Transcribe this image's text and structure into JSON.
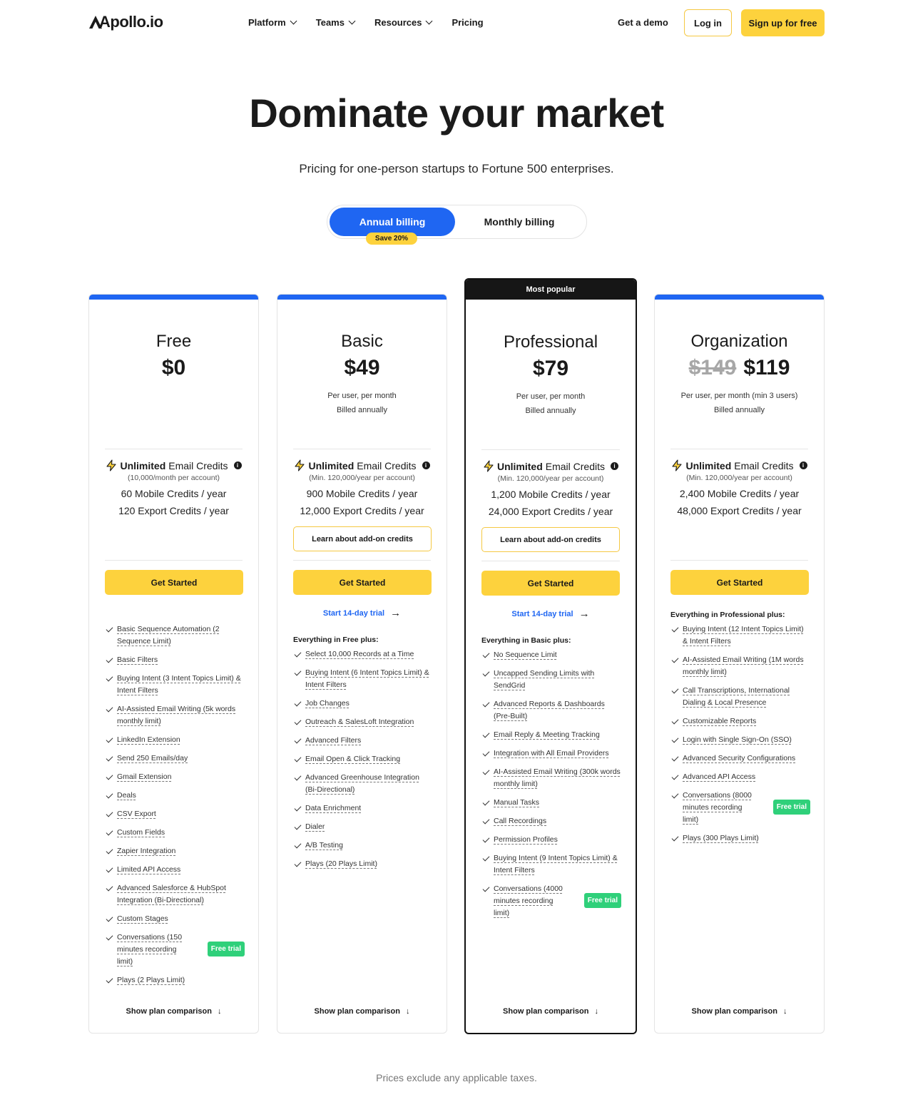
{
  "header": {
    "logo": "Apollo.io",
    "nav": [
      {
        "label": "Platform",
        "dropdown": true
      },
      {
        "label": "Teams",
        "dropdown": true
      },
      {
        "label": "Resources",
        "dropdown": true
      },
      {
        "label": "Pricing",
        "dropdown": false
      }
    ],
    "demo_label": "Get a demo",
    "login_label": "Log in",
    "signup_label": "Sign up for free"
  },
  "hero": {
    "title": "Dominate your market",
    "subtitle": "Pricing for one-person startups to Fortune 500 enterprises."
  },
  "billing": {
    "annual_label": "Annual billing",
    "monthly_label": "Monthly billing",
    "save_badge": "Save 20%",
    "selected": "annual"
  },
  "colors": {
    "accent_blue": "#1f66f2",
    "accent_yellow": "#fdd23d",
    "trial_green": "#2fd07a"
  },
  "plans": [
    {
      "name": "Free",
      "price": "$0",
      "old_price": "",
      "note1": "",
      "note2": "",
      "unlimited_bold": "Unlimited",
      "unlimited_rest": "Email Credits",
      "unlimited_sub": "(10,000/month per account)",
      "mobile": "60 Mobile Credits / year",
      "export": "120 Export Credits / year",
      "addon": "",
      "cta": "Get Started",
      "trial": "",
      "features_head": "",
      "features": [
        {
          "t": "Basic Sequence Automation (2 Sequence Limit)"
        },
        {
          "t": "Basic Filters"
        },
        {
          "t": "Buying Intent (3 Intent Topics Limit) & Intent Filters"
        },
        {
          "t": "AI-Assisted Email Writing (5k words monthly limit)"
        },
        {
          "t": "LinkedIn Extension"
        },
        {
          "t": "Send 250 Emails/day"
        },
        {
          "t": "Gmail Extension"
        },
        {
          "t": "Deals"
        },
        {
          "t": "CSV Export"
        },
        {
          "t": "Custom Fields"
        },
        {
          "t": "Zapier Integration"
        },
        {
          "t": "Limited API Access"
        },
        {
          "t": "Advanced Salesforce & HubSpot Integration (Bi-Directional)"
        },
        {
          "t": "Custom Stages"
        },
        {
          "t": "Conversations (150 minutes recording limit)",
          "badge": "Free trial"
        },
        {
          "t": "Plays (2 Plays Limit)"
        }
      ],
      "compare": "Show plan comparison"
    },
    {
      "name": "Basic",
      "price": "$49",
      "old_price": "",
      "note1": "Per user, per month",
      "note2": "Billed annually",
      "unlimited_bold": "Unlimited",
      "unlimited_rest": "Email Credits",
      "unlimited_sub": "(Min. 120,000/year per account)",
      "mobile": "900 Mobile Credits / year",
      "export": "12,000 Export Credits / year",
      "addon": "Learn about add-on credits",
      "cta": "Get Started",
      "trial": "Start 14-day trial",
      "features_head": "Everything in Free plus:",
      "features": [
        {
          "t": "Select 10,000 Records at a Time"
        },
        {
          "t": "Buying Intent (6 Intent Topics Limit) & Intent Filters"
        },
        {
          "t": "Job Changes"
        },
        {
          "t": "Outreach & SalesLoft Integration"
        },
        {
          "t": "Advanced Filters"
        },
        {
          "t": "Email Open & Click Tracking"
        },
        {
          "t": "Advanced Greenhouse Integration (Bi-Directional)"
        },
        {
          "t": "Data Enrichment"
        },
        {
          "t": "Dialer"
        },
        {
          "t": "A/B Testing"
        },
        {
          "t": "Plays (20 Plays Limit)"
        }
      ],
      "compare": "Show plan comparison"
    },
    {
      "name": "Professional",
      "price": "$79",
      "old_price": "",
      "popular_label": "Most popular",
      "note1": "Per user, per month",
      "note2": "Billed annually",
      "unlimited_bold": "Unlimited",
      "unlimited_rest": "Email Credits",
      "unlimited_sub": "(Min. 120,000/year per account)",
      "mobile": "1,200 Mobile Credits / year",
      "export": "24,000 Export Credits / year",
      "addon": "Learn about add-on credits",
      "cta": "Get Started",
      "trial": "Start 14-day trial",
      "features_head": "Everything in Basic plus:",
      "features": [
        {
          "t": "No Sequence Limit"
        },
        {
          "t": "Uncapped Sending Limits with SendGrid"
        },
        {
          "t": "Advanced Reports & Dashboards (Pre-Built)"
        },
        {
          "t": "Email Reply & Meeting Tracking"
        },
        {
          "t": "Integration with All Email Providers"
        },
        {
          "t": "AI-Assisted Email Writing (300k words monthly limit)"
        },
        {
          "t": "Manual Tasks"
        },
        {
          "t": "Call Recordings"
        },
        {
          "t": "Permission Profiles"
        },
        {
          "t": "Buying Intent (9 Intent Topics Limit) & Intent Filters"
        },
        {
          "t": "Conversations (4000 minutes recording limit)",
          "badge": "Free trial"
        }
      ],
      "compare": "Show plan comparison"
    },
    {
      "name": "Organization",
      "price": "$119",
      "old_price": "$149",
      "note1": "Per user, per month (min 3 users)",
      "note2": "Billed annually",
      "unlimited_bold": "Unlimited",
      "unlimited_rest": "Email Credits",
      "unlimited_sub": "(Min. 120,000/year per account)",
      "mobile": "2,400 Mobile Credits / year",
      "export": "48,000 Export Credits / year",
      "addon": "",
      "cta": "Get Started",
      "trial": "",
      "features_head": "Everything in Professional plus:",
      "features": [
        {
          "t": "Buying Intent (12 Intent Topics Limit) & Intent Filters"
        },
        {
          "t": "AI-Assisted Email Writing (1M words monthly limit)"
        },
        {
          "t": "Call Transcriptions, International Dialing & Local Presence"
        },
        {
          "t": "Customizable Reports"
        },
        {
          "t": "Login with Single Sign-On (SSO)"
        },
        {
          "t": "Advanced Security Configurations"
        },
        {
          "t": "Advanced API Access"
        },
        {
          "t": "Conversations (8000 minutes recording limit)",
          "badge": "Free trial"
        },
        {
          "t": "Plays (300 Plays Limit)"
        }
      ],
      "compare": "Show plan comparison"
    }
  ],
  "footer_note": "Prices exclude any applicable taxes."
}
